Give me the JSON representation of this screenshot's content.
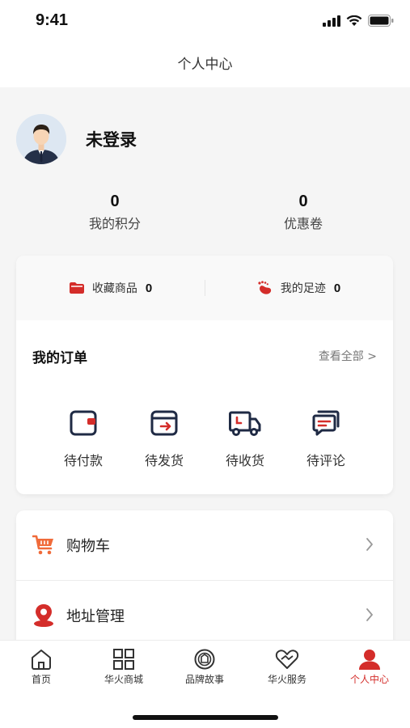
{
  "status_bar": {
    "time": "9:41"
  },
  "nav": {
    "title": "个人中心"
  },
  "profile": {
    "name": "未登录"
  },
  "stats": [
    {
      "value": "0",
      "label": "我的积分"
    },
    {
      "value": "0",
      "label": "优惠卷"
    }
  ],
  "favorites": [
    {
      "label": "收藏商品",
      "count": "0",
      "icon": "folder-icon"
    },
    {
      "label": "我的足迹",
      "count": "0",
      "icon": "footprint-icon"
    }
  ],
  "orders": {
    "title": "我的订单",
    "view_all": "查看全部 >",
    "items": [
      {
        "label": "待付款",
        "icon": "wallet-icon"
      },
      {
        "label": "待发货",
        "icon": "box-out-icon"
      },
      {
        "label": "待收货",
        "icon": "truck-icon"
      },
      {
        "label": "待评论",
        "icon": "comment-icon"
      }
    ]
  },
  "menu": [
    {
      "label": "购物车",
      "icon": "cart-icon"
    },
    {
      "label": "地址管理",
      "icon": "location-pin-icon"
    }
  ],
  "tabs": [
    {
      "label": "首页",
      "icon": "home-icon"
    },
    {
      "label": "华火商城",
      "icon": "grid-icon"
    },
    {
      "label": "品牌故事",
      "icon": "brand-badge-icon"
    },
    {
      "label": "华火服务",
      "icon": "heart-service-icon"
    },
    {
      "label": "个人中心",
      "icon": "person-icon",
      "active": true
    }
  ],
  "colors": {
    "accent": "#d42d2a",
    "icon_dark": "#1f2a44",
    "cart": "#f06b3a"
  }
}
